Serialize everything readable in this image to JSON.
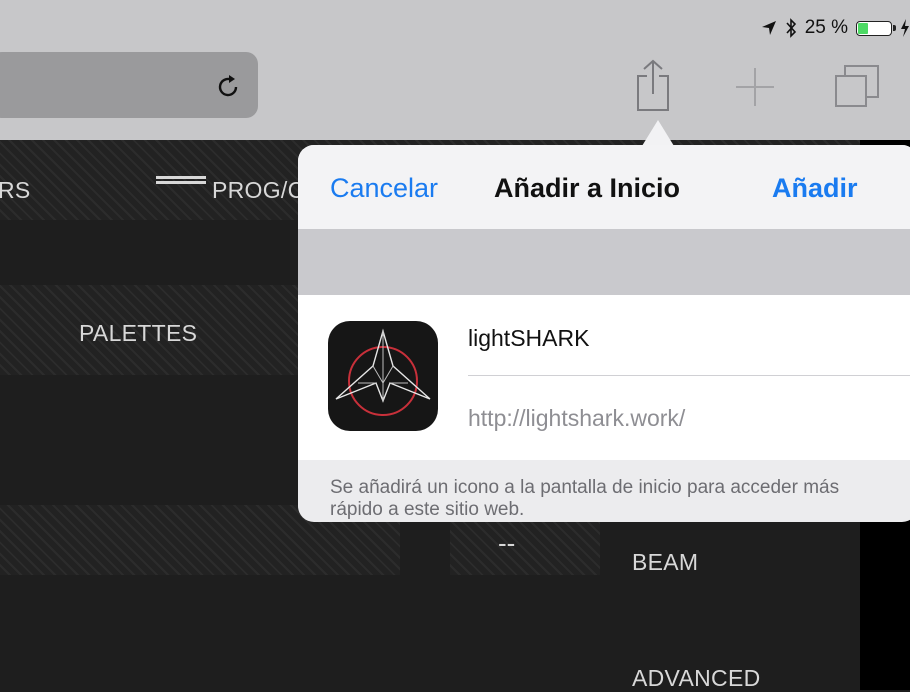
{
  "status_bar": {
    "battery": "25 %"
  },
  "browser": {
    "reload_icon": "reload-icon",
    "share_icon": "share-icon",
    "new_tab_icon": "plus-icon",
    "tabs_icon": "tabs-icon"
  },
  "page": {
    "nav_left_fragment": "RS",
    "nav_prog": "PROG/C",
    "palettes": "PALETTES",
    "dash": "--",
    "beam": "BEAM",
    "advanced": "ADVANCED"
  },
  "dialog": {
    "cancel_label": "Cancelar",
    "title": "Añadir a Inicio",
    "add_label": "Añadir",
    "app_name": "lightSHARK",
    "url": "http://lightshark.work/",
    "footer": "Se añadirá un icono a la pantalla de inicio para acceder más rápido a este sitio web."
  },
  "colors": {
    "accent": "#1a7bf0",
    "page_bg": "#1e1e1e",
    "battery_level": "#4cd964"
  }
}
